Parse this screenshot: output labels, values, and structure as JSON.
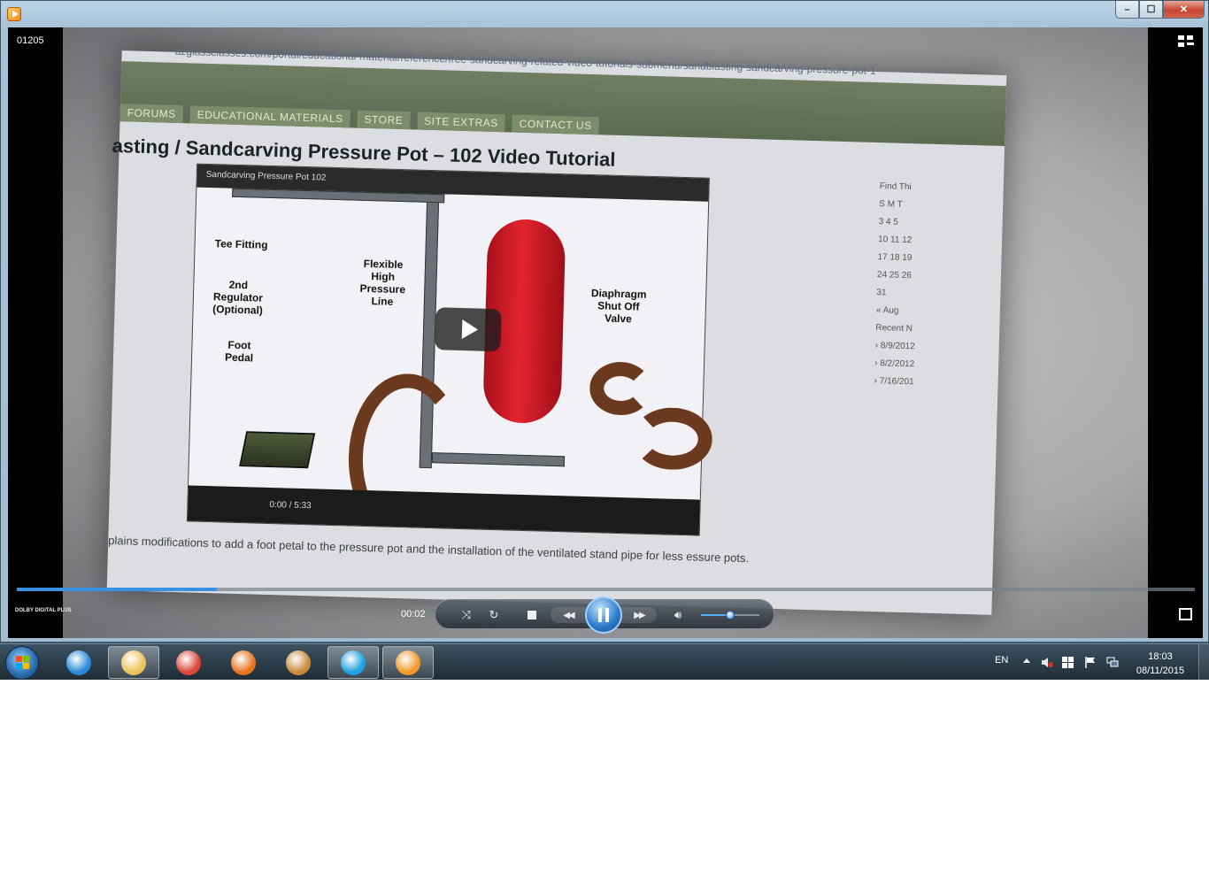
{
  "window": {
    "clip_name": "01205",
    "caption": {
      "minimize": "–",
      "maximize": "☐",
      "close": "✕"
    }
  },
  "video": {
    "site_url": "azglassclasses.com/portal/educational-material/reference/free-sandcarving-related-video-tutorials-submenu/sandblasting-sandcarving-pressure-pot-1",
    "nav": [
      "FORUMS",
      "EDUCATIONAL MATERIALS",
      "STORE",
      "SITE EXTRAS",
      "CONTACT US"
    ],
    "page_title": "asting / Sandcarving Pressure Pot – 102 Video Tutorial",
    "player_title": "Sandcarving Pressure Pot 102",
    "player_time": "0:00 / 5:33",
    "labels": {
      "tee": "Tee Fitting",
      "regulator": "2nd Regulator (Optional)",
      "hose": "Flexible High Pressure Line",
      "pedal": "Foot Pedal",
      "valve": "Diaphragm Shut Off Valve"
    },
    "description": "plains modifications to add a foot petal to the pressure pot and the installation of the ventilated stand pipe for less essure pots.",
    "sidebar": [
      "Find Thi",
      "S M T",
      "3 4 5",
      "10 11 12",
      "17 18 19",
      "24 25 26",
      "31",
      "« Aug",
      "Recent N",
      "› 8/9/2012",
      "› 8/2/2012",
      "› 7/16/201"
    ]
  },
  "player": {
    "elapsed": "00:02",
    "progress": 0.17,
    "volume": 0.5,
    "dolby": "DOLBY DIGITAL PLUS"
  },
  "taskbar": {
    "apps": [
      {
        "icon": "internet-explorer-icon",
        "color": "#2a8ad8"
      },
      {
        "icon": "file-explorer-icon",
        "color": "#e9c35a"
      },
      {
        "icon": "chrome-icon",
        "color": "#d9473a"
      },
      {
        "icon": "firefox-icon",
        "color": "#e8731f"
      },
      {
        "icon": "monkey-app-icon",
        "color": "#c98a3c"
      },
      {
        "icon": "skype-icon",
        "color": "#1da1e0"
      },
      {
        "icon": "media-player-icon",
        "color": "#f09a28"
      }
    ],
    "language": "EN",
    "time": "18:03",
    "date": "08/11/2015"
  }
}
